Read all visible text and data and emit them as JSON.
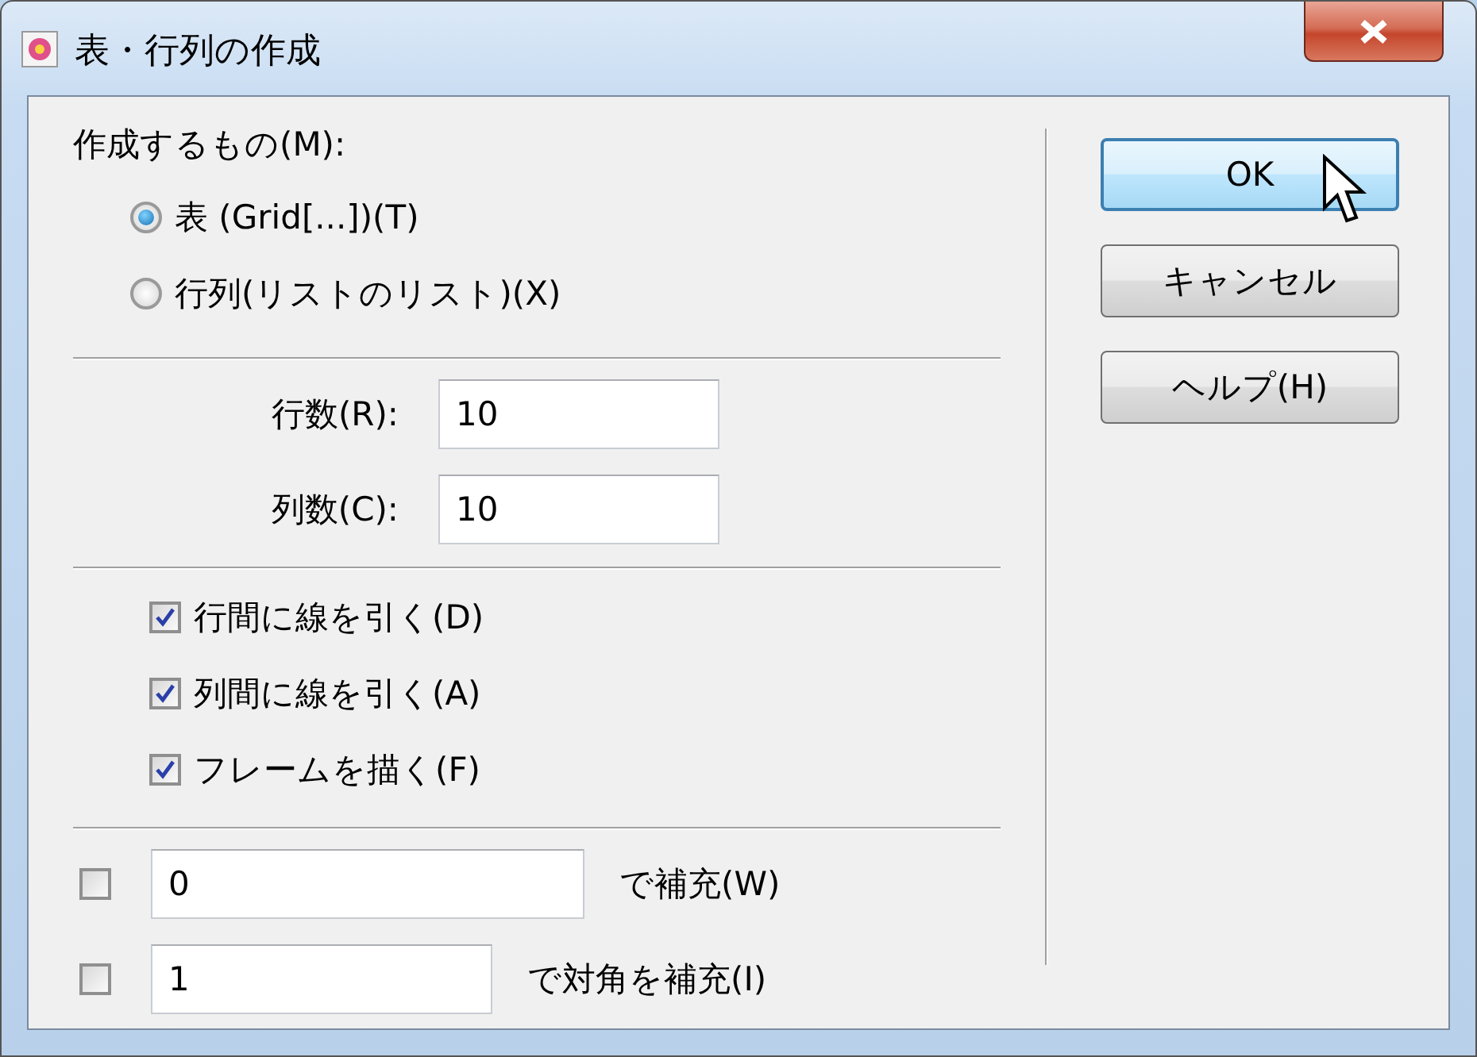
{
  "window": {
    "title": "表・行列の作成"
  },
  "create_group": {
    "label": "作成するもの(M):",
    "options": [
      {
        "label": "表 (Grid[...])(T)",
        "selected": true
      },
      {
        "label": "行列(リストのリスト)(X)",
        "selected": false
      }
    ]
  },
  "size_fields": [
    {
      "label": "行数(R):",
      "value": "10"
    },
    {
      "label": "列数(C):",
      "value": "10"
    }
  ],
  "line_options": [
    {
      "label": "行間に線を引く(D)",
      "checked": true
    },
    {
      "label": "列間に線を引く(A)",
      "checked": true
    },
    {
      "label": "フレームを描く(F)",
      "checked": true
    }
  ],
  "fill_options": [
    {
      "checked": false,
      "value": "0",
      "label": "で補充(W)"
    },
    {
      "checked": false,
      "value": "1",
      "label": "で対角を補充(I)"
    }
  ],
  "buttons": [
    {
      "label": "OK",
      "default": true
    },
    {
      "label": "キャンセル",
      "default": false
    },
    {
      "label": "ヘルプ(H)",
      "default": false
    }
  ]
}
